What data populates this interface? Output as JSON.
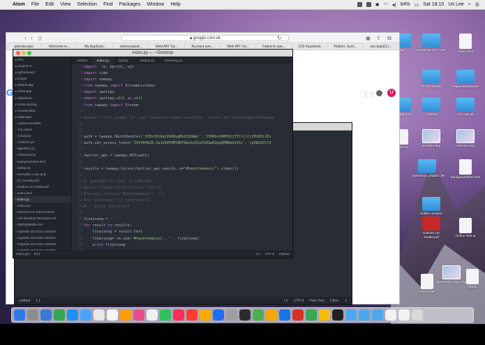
{
  "menubar": {
    "app": "Atom",
    "items": [
      "File",
      "Edit",
      "View",
      "Selection",
      "Find",
      "Packages",
      "Window",
      "Help"
    ],
    "battery": "94%",
    "clock": "Sat 18:10",
    "user": "Uri Lee"
  },
  "browser": {
    "url": "google.com.uk",
    "tabs": [
      "planetecops",
      "Welcome to...",
      "My Applicati...",
      "ctstney/spoti...",
      "Web API Tut...",
      "Account ove...",
      "Web API Tut...",
      "Failed to ope...",
      "(10) Facebook",
      "Python: Synt...",
      "sys.argv[1] I..."
    ],
    "avatar_letter": "U",
    "logo_letter": "G"
  },
  "atom": {
    "window_title": "index.py — ~/Desktop",
    "tabs": [
      "untitled",
      "index.py",
      "spotify...",
      "sidebar.py",
      "streaming.py"
    ],
    "active_tab": 1,
    "tree": [
      {
        "label": "FP4",
        "dir": true
      },
      {
        "label": "projects-2",
        "dir": true
      },
      {
        "label": "pythontweet",
        "dir": true
      },
      {
        "label": "scripts",
        "dir": true
      },
      {
        "label": "Sketch.app",
        "dir": true
      },
      {
        "label": "Slack.app",
        "dir": true
      },
      {
        "label": "slideshow",
        "dir": true
      },
      {
        "label": "Snow landing",
        "dir": true
      },
      {
        "label": "snowlanding",
        "dir": true
      },
      {
        "label": "twitterapp",
        "dir": true
      },
      {
        "label": ".cache-ieeu3581",
        "dir": false
      },
      {
        "label": ".DS_Store",
        "dir": false
      },
      {
        "label": ".localized",
        "dir": false
      },
      {
        "label": "1706197.px",
        "dir": false
      },
      {
        "label": "algorithm.py",
        "dir": false
      },
      {
        "label": "Artboard.png",
        "dir": false
      },
      {
        "label": "backgroundent.html",
        "dir": false
      },
      {
        "label": "delete.txt",
        "dir": false
      },
      {
        "label": "Everyskin Logo.png",
        "dir": false
      },
      {
        "label": "fct_monday.pdf",
        "dir": false
      },
      {
        "label": "Holition UX Toolkit.pdf",
        "dir": false
      },
      {
        "label": "index.html",
        "dir": false
      },
      {
        "label": "index.py",
        "dir": false,
        "selected": true
      },
      {
        "label": "index.pyc",
        "dir": false
      },
      {
        "label": "Intercom-on-Jobs-to-be-D",
        "dir": false
      },
      {
        "label": "Life Drawing Participant Inf",
        "dir": false
      },
      {
        "label": "Myfirstjsfiddle.htm",
        "dir": false
      },
      {
        "label": "myprefix.20171111-182426",
        "dir": false
      },
      {
        "label": "myprefix.20171111-182451",
        "dir": false
      },
      {
        "label": "myprefix.20171111-182626",
        "dir": false
      },
      {
        "label": "myprefix.20171111-182654",
        "dir": false
      }
    ],
    "line_numbers": [
      "1",
      "2",
      "3",
      "4",
      "5",
      "6",
      "7",
      "8",
      "9",
      "10",
      "11",
      "12",
      "13",
      "14",
      "15",
      "16",
      "17",
      "18",
      "19",
      "20",
      "21",
      "22",
      "23",
      "24",
      "25",
      "26",
      "27",
      "28",
      "29",
      "30"
    ],
    "code": [
      [
        [
          "kw",
          "import"
        ],
        [
          "",
          "  re, pprint, sys"
        ]
      ],
      [
        [
          "kw",
          "import"
        ],
        [
          "",
          " time"
        ]
      ],
      [
        [
          "kw",
          "import"
        ],
        [
          "",
          " tweepy"
        ]
      ],
      [
        [
          "kw",
          "from"
        ],
        [
          "",
          " tweepy "
        ],
        [
          "kw",
          "import"
        ],
        [
          "",
          " StreamListener"
        ]
      ],
      [
        [
          "kw",
          "import"
        ],
        [
          "",
          " spotipy"
        ]
      ],
      [
        [
          "kw",
          "import"
        ],
        [
          "",
          " spotipy.util "
        ],
        [
          "kw",
          "as"
        ],
        [
          "",
          " util"
        ]
      ],
      [
        [
          "kw",
          "from"
        ],
        [
          "",
          " tweepy "
        ],
        [
          "kw",
          "import"
        ],
        [
          "",
          " Stream"
        ]
      ],
      [
        [
          "",
          ""
        ]
      ],
      [
        [
          "cm",
          "#token = util.prompt_for_user_token(username='ieeu3581', client_id='2e7dc5a56ef0454daa8"
        ]
      ],
      [
        [
          "",
          ""
        ]
      ],
      [
        [
          "",
          ""
        ]
      ],
      [
        [
          "",
          "auth = tweepy.OAuthHandler("
        ],
        [
          "str",
          "'SfBiJ0tRqCVA9BygMxD2QSWpt'"
        ],
        [
          "",
          ","
        ],
        [
          "str",
          "'J39KhnJ4MYD2jTYttjlCx1MiBZi1Ev"
        ]
      ],
      [
        [
          "",
          "auth.set_access_token("
        ],
        [
          "str",
          "'355494628-3aJoDVP0MlBQYDwnGy91yhS0SwKZgwQ6M8pmJUhx'"
        ],
        [
          "",
          ","
        ],
        [
          "str",
          "'rgOW22QlYZ"
        ]
      ],
      [
        [
          "",
          ""
        ]
      ],
      [
        [
          "",
          "twitter_api = tweepy.API(auth)"
        ]
      ],
      [
        [
          "",
          ""
        ]
      ],
      [
        [
          "",
          "results = tweepy.Cursor(twitter_api.search, q="
        ],
        [
          "str",
          "\"#hashthemusic\""
        ],
        [
          "",
          ").items("
        ],
        [
          "num",
          "1"
        ],
        [
          "",
          ")"
        ]
      ],
      [
        [
          "",
          ""
        ]
      ],
      [
        [
          "cm",
          "#, geocode=\"51.5187,-0.1188,5km\""
        ]
      ],
      [
        [
          "cm",
          "#print stream.filter(track=['nice'])"
        ]
      ],
      [
        [
          "cm",
          "#results.replace(\"#hashthemusic\", \"\")"
        ]
      ],
      [
        [
          "cm",
          "#for testresult in testresults:"
        ]
      ],
      [
        [
          "cm",
          "#    print testresult"
        ]
      ],
      [
        [
          "",
          ""
        ]
      ],
      [
        [
          "",
          "finalsong = "
        ],
        [
          "str",
          "''"
        ]
      ],
      [
        [
          "kw",
          "for"
        ],
        [
          "",
          " result "
        ],
        [
          "kw",
          "in"
        ],
        [
          "",
          " results:"
        ]
      ],
      [
        [
          "",
          "    finalsong = result.text"
        ]
      ],
      [
        [
          "",
          "    finalsong= re.sub("
        ],
        [
          "str",
          "'#hashthemusic'"
        ],
        [
          "",
          ", "
        ],
        [
          "str",
          "''"
        ],
        [
          "",
          ", finalsong)"
        ]
      ],
      [
        [
          "",
          "    "
        ],
        [
          "kw",
          "print"
        ],
        [
          "",
          " finalsong"
        ]
      ],
      [
        [
          "",
          ""
        ]
      ],
      [
        [
          "kw",
          "if"
        ],
        [
          "",
          " len(sys.argv) > "
        ],
        [
          "num",
          "3"
        ],
        [
          "",
          ":"
        ]
      ]
    ],
    "status": {
      "file": "index.py*",
      "position": "63:1",
      "eol": "LF",
      "encoding": "UTF-8",
      "grammar": "Python"
    }
  },
  "atom2": {
    "status_left": "untitled",
    "status_pos": "1:1",
    "eol": "LF",
    "encoding": "UTF-8",
    "grammar": "Plain Text",
    "files": "0 files"
  },
  "desktop_icons": [
    {
      "label": "log",
      "kind": "folder"
    },
    {
      "label": "bootstrap-3.3.7-dist",
      "kind": "folder"
    },
    {
      "label": "index.html",
      "kind": "doc"
    },
    {
      "label": "GCSE results",
      "kind": "folder"
    },
    {
      "label": "happinessplanpal",
      "kind": "folder"
    },
    {
      "label": "und.pla and",
      "kind": "folder"
    },
    {
      "label": "codefirst",
      "kind": "folder"
    },
    {
      "label": "Am App all",
      "kind": "folder"
    },
    {
      "label": "slide.txt",
      "kind": "doc"
    },
    {
      "label": "snowlanding",
      "kind": "img"
    },
    {
      "label": "Artboard.png",
      "kind": "img"
    },
    {
      "label": "styleclone_jsfiddle_file",
      "kind": "folder"
    },
    {
      "label": "backgroundent.html",
      "kind": "doc"
    },
    {
      "label": "holition project",
      "kind": "folder"
    },
    {
      "label": "Holition UX Toolkit.pdf",
      "kind": "red"
    },
    {
      "label": "Online Test.ai",
      "kind": "doc"
    },
    {
      "label": "Everyskin Logo.png",
      "kind": "img"
    },
    {
      "label": "week3.pdf",
      "kind": "doc"
    },
    {
      "label": "Slack",
      "kind": "doc"
    }
  ]
}
